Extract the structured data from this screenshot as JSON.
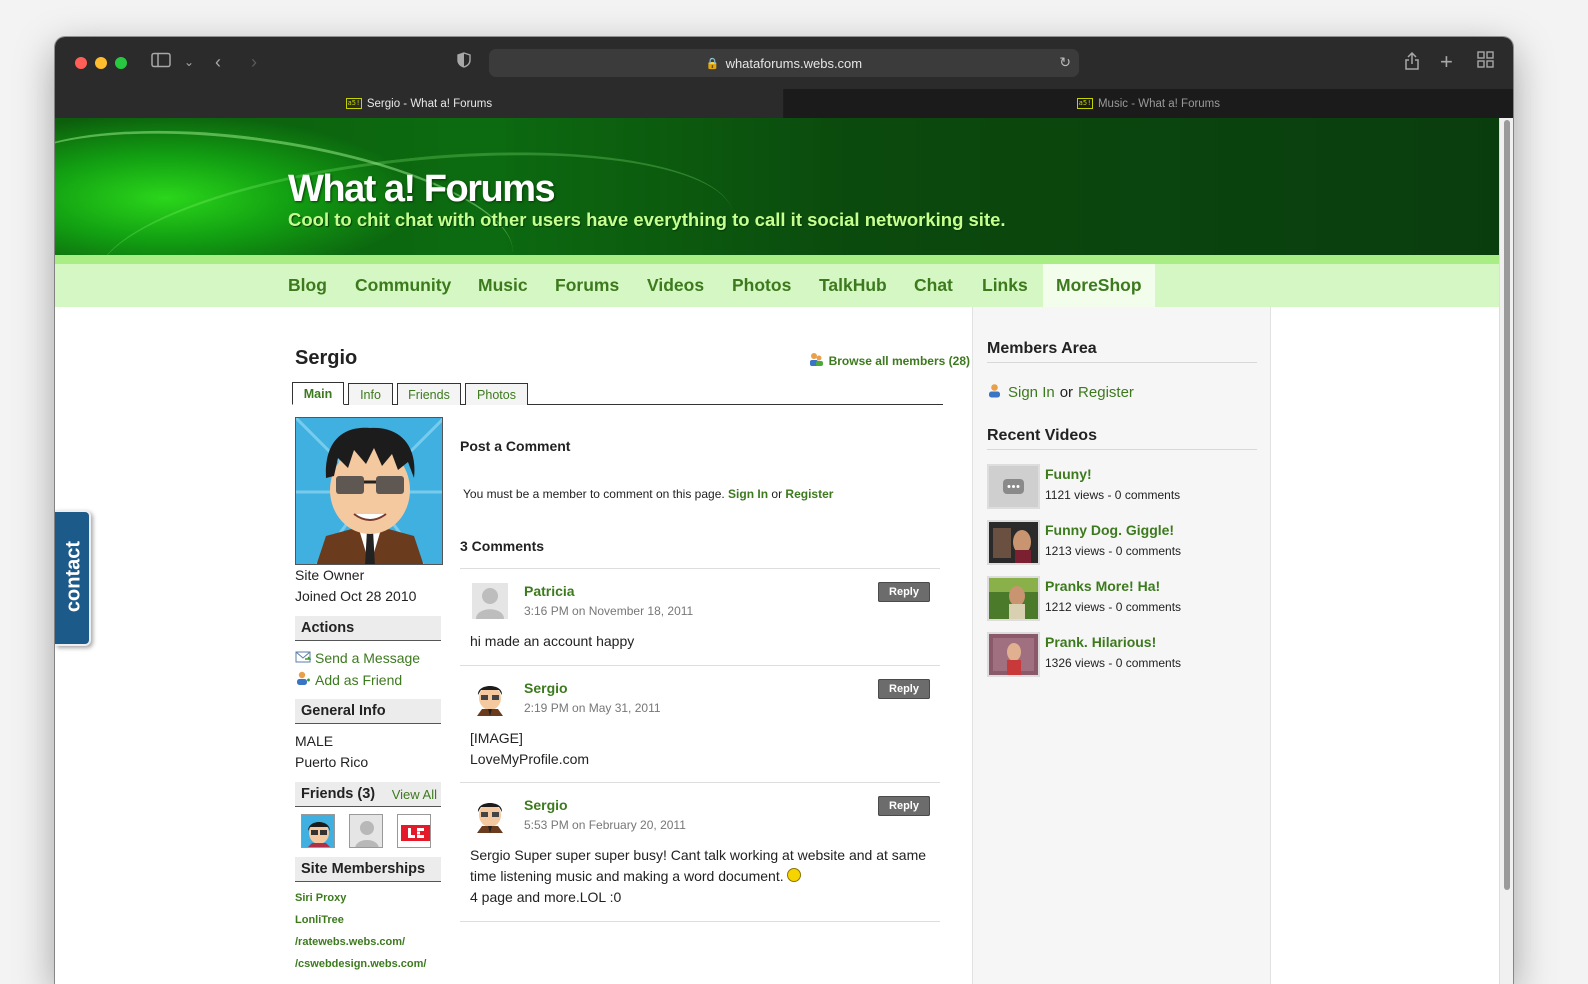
{
  "browser": {
    "url": "whataforums.webs.com",
    "tabs": [
      {
        "label": "Sergio - What a! Forums",
        "favicon": "a5!"
      },
      {
        "label": "Music - What a! Forums",
        "favicon": "a5!"
      }
    ]
  },
  "site": {
    "title": "What a! Forums",
    "tagline": "Cool to chit chat with other users have everything to call it social networking site.",
    "accent_color": "#3d7a1e"
  },
  "nav": {
    "items": [
      "Blog",
      "Community",
      "Music",
      "Forums",
      "Videos",
      "Photos",
      "TalkHub",
      "Chat",
      "Links",
      "MoreShop"
    ],
    "active": "MoreShop"
  },
  "profile": {
    "name": "Sergio",
    "browse_link": "Browse all members (28)",
    "tabs": [
      "Main",
      "Info",
      "Friends",
      "Photos"
    ],
    "active_tab": "Main",
    "role": "Site Owner",
    "joined": "Joined Oct 28 2010",
    "actions_heading": "Actions",
    "send_message": "Send a Message",
    "add_friend": "Add as Friend",
    "general_info_heading": "General Info",
    "gender": "MALE",
    "location": "Puerto Rico",
    "friends_heading": "Friends (3)",
    "view_all": "View All",
    "memberships_heading": "Site Memberships",
    "memberships": [
      "Siri Proxy",
      "LonliTree",
      "/ratewebs.webs.com/",
      "/cswebdesign.webs.com/"
    ]
  },
  "comments_section": {
    "post_heading": "Post a Comment",
    "member_note": "You must be a member to comment on this page.",
    "sign_in": "Sign In",
    "or": "or",
    "register": "Register",
    "count_heading": "3 Comments",
    "reply_label": "Reply",
    "comments": [
      {
        "author": "Patricia",
        "time": "3:16 PM on November 18, 2011",
        "lines": [
          "hi made an account happy"
        ]
      },
      {
        "author": "Sergio",
        "time": "2:19 PM on May 31, 2011",
        "lines": [
          "[IMAGE]",
          "LoveMyProfile.com"
        ]
      },
      {
        "author": "Sergio",
        "time": "5:53 PM on February 20, 2011",
        "lines": [
          "Sergio Super super super busy! Cant talk working at website and at same",
          "time listening music and making a word document.",
          "4 page and more.LOL :0"
        ]
      }
    ]
  },
  "sidebar": {
    "members_heading": "Members Area",
    "sign_in": "Sign In",
    "or": "or",
    "register": "Register",
    "videos_heading": "Recent Videos",
    "videos": [
      {
        "title": "Fuuny!",
        "meta": "1121 views - 0 comments"
      },
      {
        "title": "Funny Dog. Giggle!",
        "meta": "1213 views - 0 comments"
      },
      {
        "title": "Pranks More! Ha!",
        "meta": "1212 views - 0 comments"
      },
      {
        "title": "Prank. Hilarious!",
        "meta": "1326 views - 0 comments"
      }
    ]
  },
  "contact_tab": "contact"
}
